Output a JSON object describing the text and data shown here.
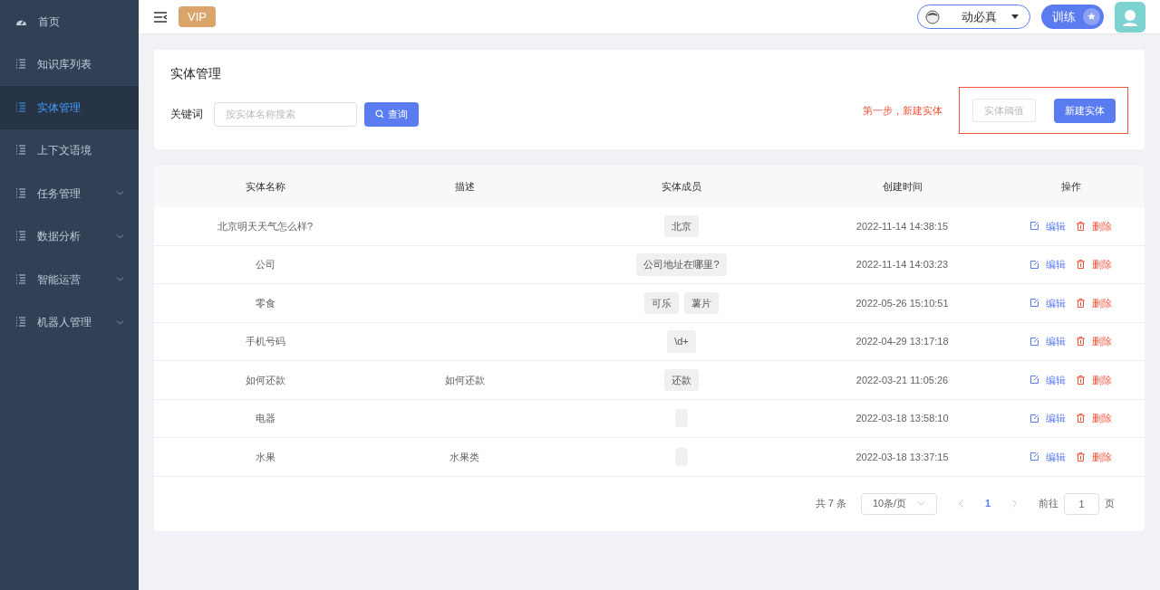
{
  "sidebar": {
    "items": [
      {
        "label": "首页",
        "kind": "dashboard",
        "selected": false,
        "expandable": false
      },
      {
        "label": "知识库列表",
        "kind": "list",
        "selected": false,
        "expandable": false
      },
      {
        "label": "实体管理",
        "kind": "list",
        "selected": true,
        "expandable": false
      },
      {
        "label": "上下文语境",
        "kind": "list",
        "selected": false,
        "expandable": false
      },
      {
        "label": "任务管理",
        "kind": "list",
        "selected": false,
        "expandable": true
      },
      {
        "label": "数据分析",
        "kind": "list",
        "selected": false,
        "expandable": true
      },
      {
        "label": "智能运营",
        "kind": "list",
        "selected": false,
        "expandable": true
      },
      {
        "label": "机器人管理",
        "kind": "list",
        "selected": false,
        "expandable": true
      }
    ]
  },
  "header": {
    "badge": "VIP",
    "user": "动必真",
    "train_button": "训练"
  },
  "panel": {
    "title": "实体管理",
    "keyword_label": "关键词",
    "search": {
      "placeholder": "按实体名称搜索"
    },
    "query_button": "查询",
    "hint": "第一步，新建实体",
    "threshold_button": "实体阈值",
    "new_button": "新建实体"
  },
  "table": {
    "columns": [
      "实体名称",
      "描述",
      "实体成员",
      "创建时间",
      "操作"
    ],
    "rows": [
      {
        "name": "北京明天天气怎么样?",
        "description": "",
        "members": [
          "北京"
        ],
        "blank_tag": false,
        "created": "2022-11-14 14:38:15",
        "edit": "编辑",
        "delete": "删除"
      },
      {
        "name": "公司",
        "description": "",
        "members": [
          "公司地址在哪里?"
        ],
        "blank_tag": false,
        "created": "2022-11-14 14:03:23",
        "edit": "编辑",
        "delete": "删除"
      },
      {
        "name": "零食",
        "description": "",
        "members": [
          "可乐",
          "薯片"
        ],
        "blank_tag": false,
        "created": "2022-05-26 15:10:51",
        "edit": "编辑",
        "delete": "删除"
      },
      {
        "name": "手机号码",
        "description": "",
        "members": [
          "\\d+"
        ],
        "blank_tag": false,
        "created": "2022-04-29 13:17:18",
        "edit": "编辑",
        "delete": "删除"
      },
      {
        "name": "如何还款",
        "description": "如何还款",
        "members": [
          "还款"
        ],
        "blank_tag": false,
        "created": "2022-03-21 11:05:26",
        "edit": "编辑",
        "delete": "删除"
      },
      {
        "name": "电器",
        "description": "",
        "members": [],
        "blank_tag": true,
        "created": "2022-03-18 13:58:10",
        "edit": "编辑",
        "delete": "删除"
      },
      {
        "name": "水果",
        "description": "水果类",
        "members": [],
        "blank_tag": true,
        "created": "2022-03-18 13:37:15",
        "edit": "编辑",
        "delete": "删除"
      }
    ]
  },
  "pagination": {
    "total": "共 7 条",
    "page_size": "10条/页",
    "pages": [
      {
        "label": "1",
        "selected": true
      }
    ],
    "goto_label": "前往",
    "goto_value": "1",
    "goto_suffix": "页"
  }
}
